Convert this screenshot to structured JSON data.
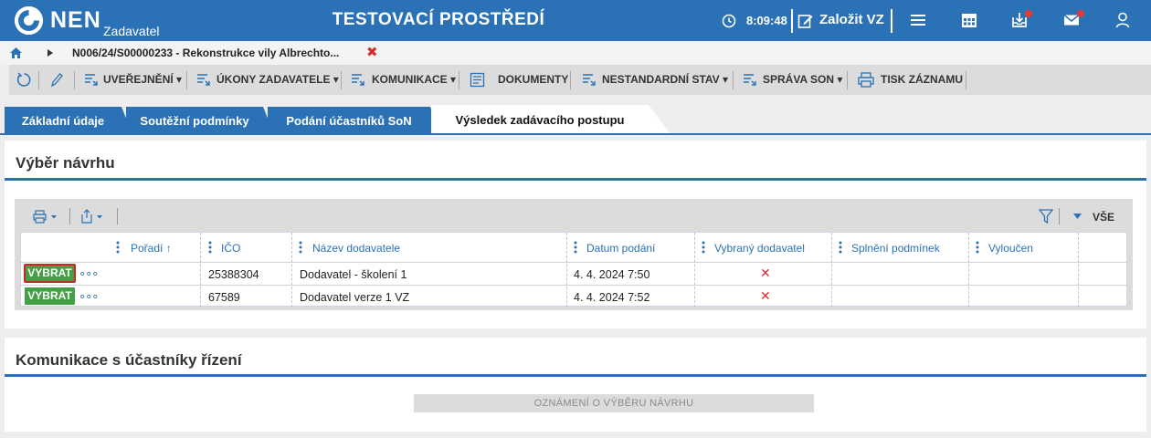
{
  "header": {
    "brand": "NEN",
    "brand_sub": "Zadavatel",
    "env_title": "TESTOVACÍ PROSTŘEDÍ",
    "time": "8:09:48",
    "new_vz_label": "Založit VZ"
  },
  "breadcrumb": {
    "text": "N006/24/S00000233 - Rekonstrukce vily Albrechto...",
    "close": "✖"
  },
  "toolbar": {
    "items": [
      {
        "label": "UVEŘEJNĚNÍ ▾"
      },
      {
        "label": "ÚKONY ZADAVATELE ▾"
      },
      {
        "label": "KOMUNIKACE ▾"
      },
      {
        "label": "DOKUMENTY"
      },
      {
        "label": "NESTANDARDNÍ STAV ▾"
      },
      {
        "label": "SPRÁVA SON ▾"
      },
      {
        "label": "TISK ZÁZNAMU"
      }
    ]
  },
  "tabs": [
    {
      "label": "Základní údaje"
    },
    {
      "label": "Soutěžní podmínky"
    },
    {
      "label": "Podání účastníků SoN"
    },
    {
      "label": "Výsledek zadávacího postupu"
    }
  ],
  "section1": {
    "title": "Výběr návrhu",
    "filter_all": "VŠE",
    "columns": [
      "Pořadí ↑",
      "IČO",
      "Název dodavatele",
      "Datum podání",
      "Vybraný dodavatel",
      "Splnění podmínek",
      "Vyloučen"
    ],
    "rows": [
      {
        "action": "VYBRAT",
        "more": "∘∘∘",
        "ico": "25388304",
        "name": "Dodavatel - školení 1",
        "date": "4. 4. 2024 7:50",
        "selected": "✕"
      },
      {
        "action": "VYBRAT",
        "more": "∘∘∘",
        "ico": "67589",
        "name": "Dodavatel verze 1 VZ",
        "date": "4. 4. 2024 7:52",
        "selected": "✕"
      }
    ]
  },
  "section2": {
    "title": "Komunikace s účastníky řízení",
    "notice_button": "OZNÁMENÍ O VÝBĚRU NÁVRHU"
  },
  "colors": {
    "primary": "#2a72b5",
    "action_green": "#43a047",
    "alert_red": "#d32f2f"
  }
}
